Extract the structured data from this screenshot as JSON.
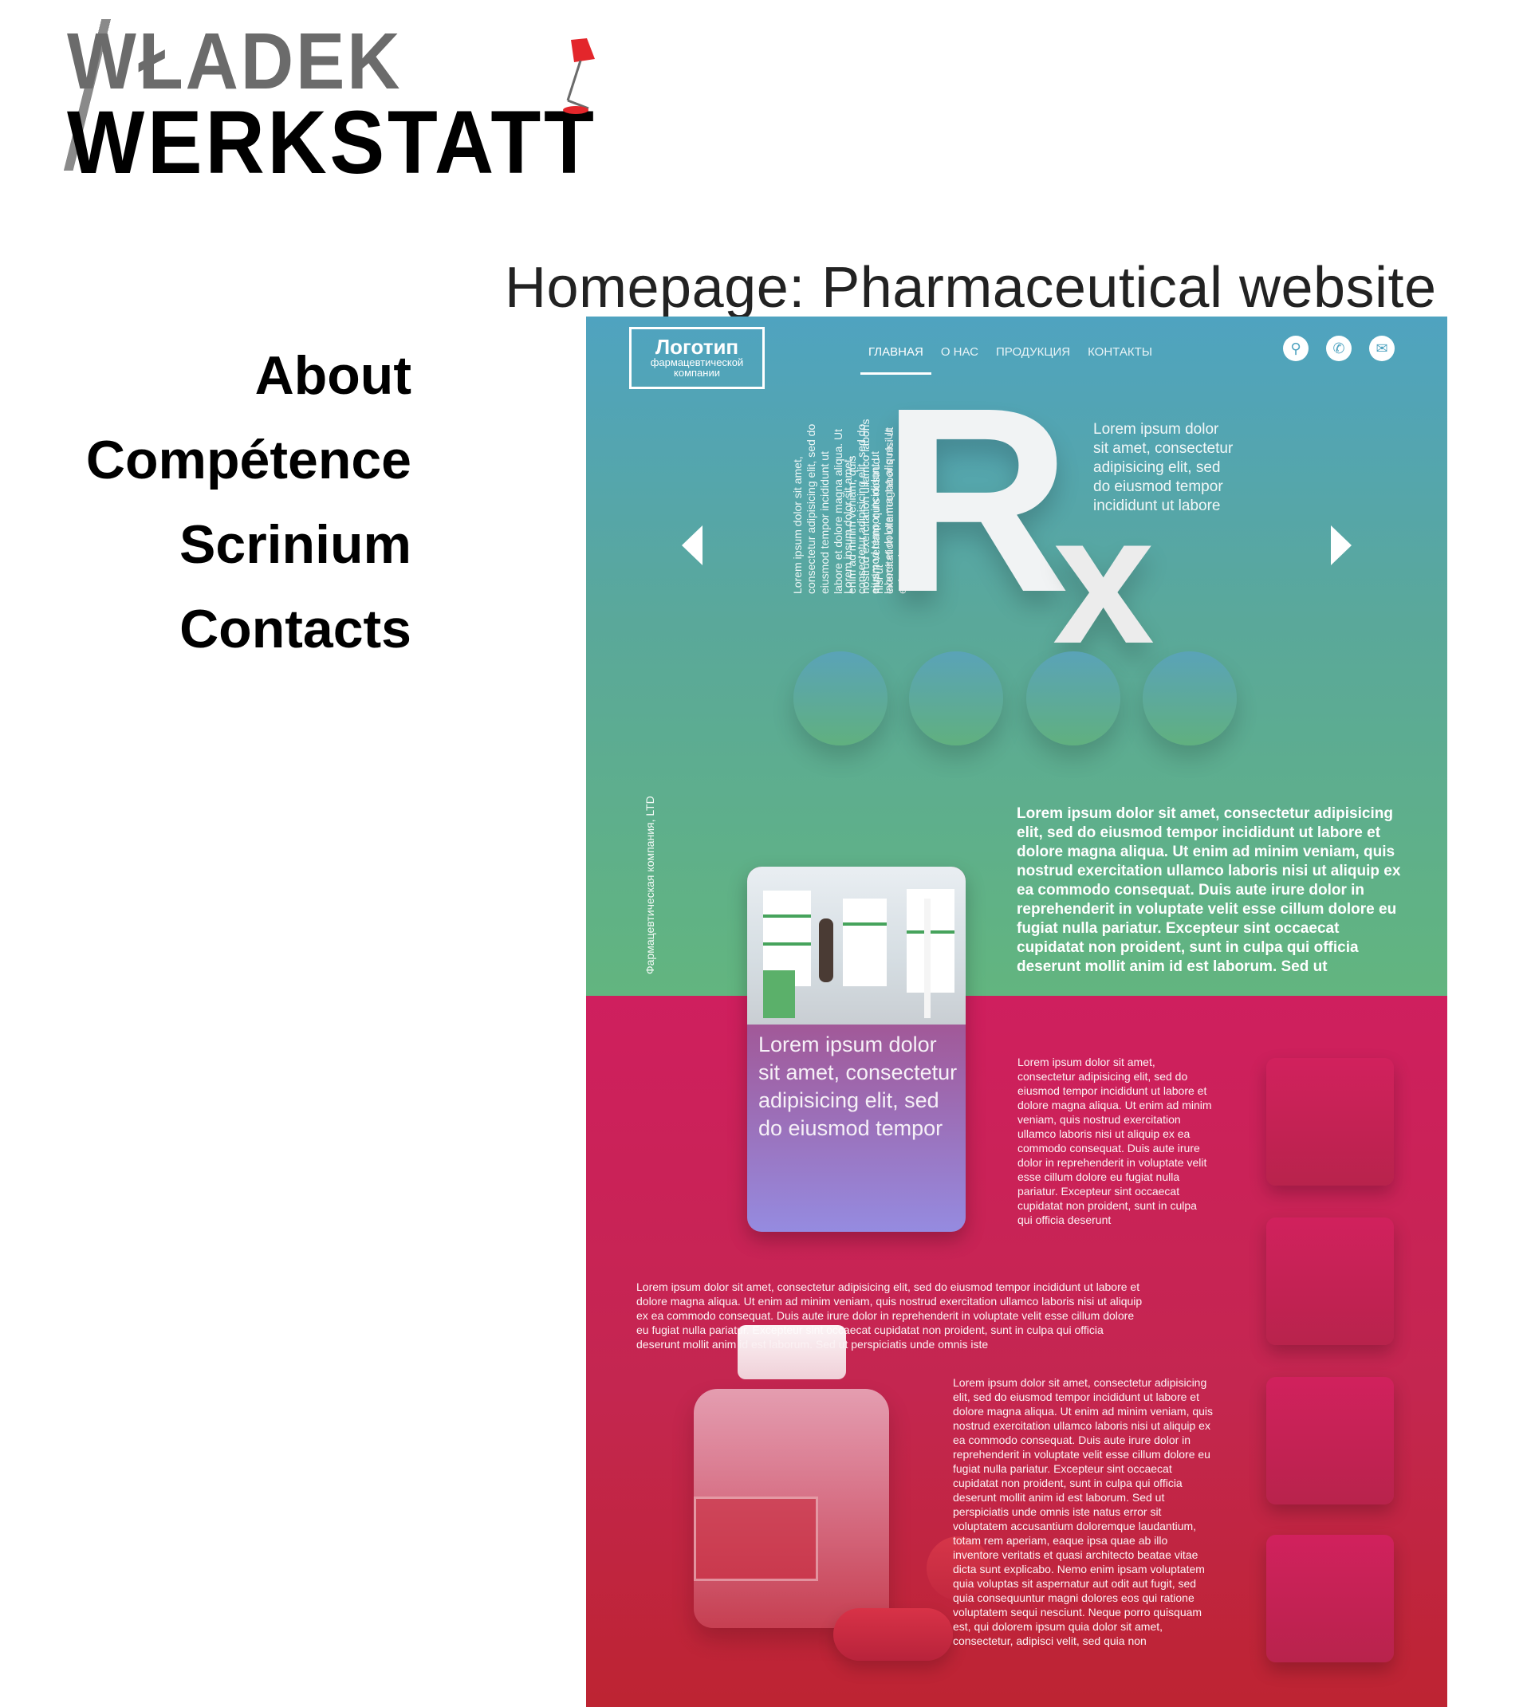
{
  "site": {
    "logo_line1": "WŁADEK",
    "logo_line2": "WERKSTATT"
  },
  "nav": [
    "About",
    "Compétence",
    "Scrinium",
    "Contacts"
  ],
  "project_title": "Homepage: Pharmaceutical website",
  "mock": {
    "logo_title": "Логотип",
    "logo_sub": "фармацевтической компании",
    "menu": [
      "ГЛАВНАЯ",
      "О НАС",
      "ПРОДУКЦИЯ",
      "КОНТАКТЫ"
    ],
    "icons": [
      "search-icon",
      "phone-icon",
      "mail-icon"
    ],
    "rx_r": "R",
    "rx_x": "x",
    "hero_side_text": "Lorem ipsum dolor sit amet, consectetur adipisicing elit, sed do eiusmod tempor incididunt ut labore",
    "vertical_texts": [
      "Lorem ipsum dolor sit amet, consectetur adipisicing elit, sed do eiusmod tempor incididunt ut labore et dolore magna aliqua. Ut enim ad minim veniam, quis nostrud exercitation ullamco laboris nisi ut",
      "Lorem ipsum dolor sit amet, consectetur adipisicing elit, sed do eiusmod tempor incididunt ut labore et dolore magna aliqua. Ut enim ad",
      "minim veniam, quis nostrud exercitation ullamco laboris nisi ut"
    ],
    "vertical_brand": "Фармацевтическая компания, LTD",
    "hero_bold_text": "Lorem ipsum dolor sit amet, consectetur adipisicing elit, sed do eiusmod tempor incididunt ut labore et dolore magna aliqua. Ut enim ad minim veniam, quis nostrud exercitation ullamco laboris nisi ut aliquip ex ea commodo consequat. Duis aute irure dolor in reprehenderit in voluptate velit esse cillum dolore eu fugiat nulla pariatur. Excepteur sint occaecat cupidatat non proident, sunt in culpa qui officia deserunt mollit anim id est laborum. Sed ut",
    "card_text": "Lorem ipsum dolor sit amet, consectetur adipisicing elit, sed do eiusmod tempor",
    "col1_text": "Lorem ipsum dolor sit amet, consectetur adipisicing elit, sed do eiusmod tempor incididunt ut labore et dolore magna aliqua. Ut enim ad minim veniam, quis nostrud exercitation ullamco laboris nisi ut aliquip ex ea commodo consequat. Duis aute irure dolor in reprehenderit in voluptate velit esse cillum dolore eu fugiat nulla pariatur. Excepteur sint occaecat cupidatat non proident, sunt in culpa qui officia deserunt",
    "col2_text": "Lorem ipsum dolor sit amet, consectetur adipisicing elit, sed do eiusmod tempor incididunt ut labore et dolore magna aliqua. Ut enim ad minim veniam, quis nostrud exercitation ullamco laboris nisi ut aliquip ex ea commodo consequat. Duis aute irure dolor in reprehenderit in voluptate velit esse cillum dolore eu fugiat nulla pariatur. Excepteur sint occaecat cupidatat non proident, sunt in culpa qui officia deserunt mollit anim id est laborum. Sed ut perspiciatis unde omnis iste",
    "col3_text": "Lorem ipsum dolor sit amet, consectetur adipisicing elit, sed do eiusmod tempor incididunt ut labore et dolore magna aliqua. Ut enim ad minim veniam, quis nostrud exercitation ullamco laboris nisi ut aliquip ex ea commodo consequat. Duis aute irure dolor in reprehenderit in voluptate velit esse cillum dolore eu fugiat nulla pariatur. Excepteur sint occaecat cupidatat non proident, sunt in culpa qui officia deserunt mollit anim id est laborum. Sed ut perspiciatis unde omnis iste natus error sit voluptatem accusantium doloremque laudantium, totam rem aperiam, eaque ipsa quae ab illo inventore veritatis et quasi architecto beatae vitae dicta sunt explicabo. Nemo enim ipsam voluptatem quia voluptas sit aspernatur aut odit aut fugit, sed quia consequuntur magni dolores eos qui ratione voluptatem sequi nesciunt. Neque porro quisquam est, qui dolorem ipsum quia dolor sit amet, consectetur, adipisci velit, sed quia non"
  },
  "colors": {
    "hero_top": "#4fa3c0",
    "hero_bottom": "#62b57f",
    "lower_top": "#cf1f5e",
    "lower_bottom": "#bd2432",
    "logo_grey": "#6b6b6b",
    "lamp_red": "#e3262b"
  }
}
